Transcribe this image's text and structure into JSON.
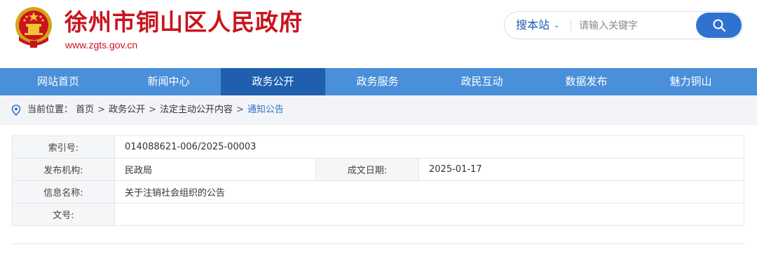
{
  "header": {
    "site_name": "徐州市铜山区人民政府",
    "site_url": "www.zgts.gov.cn",
    "emblem_icon": "national-emblem-icon"
  },
  "search": {
    "scope_label": "搜本站",
    "placeholder": "请输入关键字",
    "button_icon": "search-icon"
  },
  "nav": {
    "items": [
      "网站首页",
      "新闻中心",
      "政务公开",
      "政务服务",
      "政民互动",
      "数据发布",
      "魅力铜山"
    ],
    "active_index": 2
  },
  "breadcrumb": {
    "prefix": "当前位置：",
    "items": [
      "首页",
      "政务公开",
      "法定主动公开内容"
    ],
    "current": "通知公告",
    "separator": ">"
  },
  "info_table": {
    "index_label": "索引号:",
    "index_value": "014088621-006/2025-00003",
    "publisher_label": "发布机构:",
    "publisher_value": "民政局",
    "date_label": "成文日期:",
    "date_value": "2025-01-17",
    "title_label": "信息名称:",
    "title_value": "关于注销社会组织的公告",
    "docno_label": "文号:",
    "docno_value": ""
  },
  "colors": {
    "brand_red": "#c8141e",
    "nav_blue": "#4a8fd9",
    "nav_active": "#1f5fae",
    "accent_blue": "#2f72d0"
  }
}
